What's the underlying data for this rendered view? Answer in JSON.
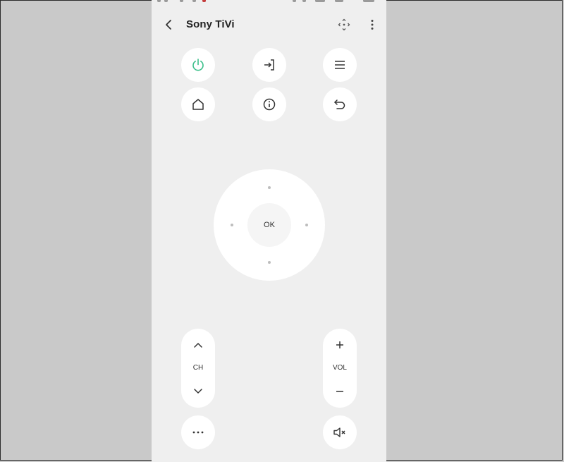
{
  "header": {
    "title": "Sony TiVi"
  },
  "icons": {
    "back": "chevron-left-icon",
    "touchpad": "touchpad-icon",
    "more": "vertical-dots-icon",
    "power": "power-icon",
    "input": "input-source-icon",
    "menu": "menu-icon",
    "home": "home-icon",
    "info": "info-icon",
    "return": "return-icon",
    "options": "horizontal-dots-icon",
    "mute": "mute-icon"
  },
  "colors": {
    "power_accent": "#3bbf8a",
    "background": "#efefef",
    "button": "#ffffff"
  },
  "dpad": {
    "ok_label": "OK"
  },
  "channel": {
    "label": "CH"
  },
  "volume": {
    "label": "VOL"
  }
}
